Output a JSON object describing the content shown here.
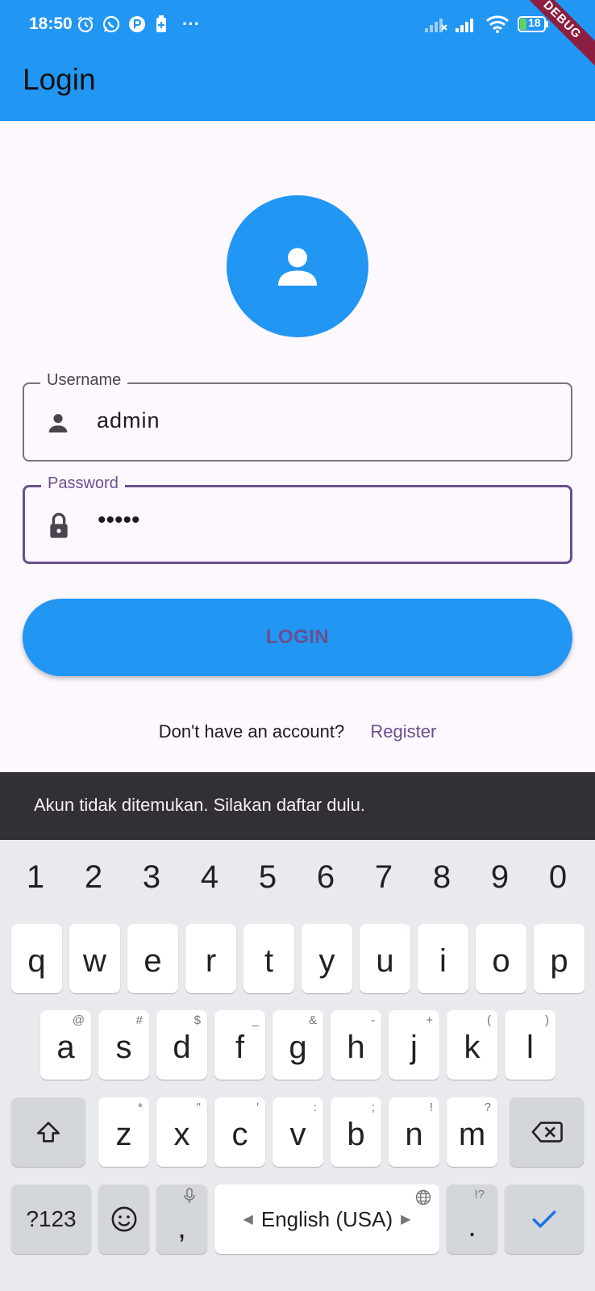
{
  "status_bar": {
    "time": "18:50",
    "battery": "18",
    "icons": [
      "alarm-icon",
      "whatsapp-icon",
      "app-icon",
      "battery-saver-icon",
      "more-icon",
      "signal-1-icon",
      "signal-2-icon",
      "wifi-icon",
      "battery-icon"
    ]
  },
  "debug_banner": "DEBUG",
  "app_bar": {
    "title": "Login"
  },
  "form": {
    "username": {
      "label": "Username",
      "value": "admin"
    },
    "password": {
      "label": "Password",
      "value": "•••••"
    },
    "login_button": "LOGIN",
    "register_prompt": "Don't have an account?",
    "register_link": "Register"
  },
  "snackbar": {
    "message": "Akun tidak ditemukan. Silakan daftar dulu."
  },
  "keyboard": {
    "numbers": [
      "1",
      "2",
      "3",
      "4",
      "5",
      "6",
      "7",
      "8",
      "9",
      "0"
    ],
    "row1": [
      "q",
      "w",
      "e",
      "r",
      "t",
      "y",
      "u",
      "i",
      "o",
      "p"
    ],
    "row2": [
      {
        "ch": "a",
        "hint": "@"
      },
      {
        "ch": "s",
        "hint": "#"
      },
      {
        "ch": "d",
        "hint": "$"
      },
      {
        "ch": "f",
        "hint": "_"
      },
      {
        "ch": "g",
        "hint": "&"
      },
      {
        "ch": "h",
        "hint": "-"
      },
      {
        "ch": "j",
        "hint": "+"
      },
      {
        "ch": "k",
        "hint": "("
      },
      {
        "ch": "l",
        "hint": ")"
      }
    ],
    "row3": [
      {
        "ch": "z",
        "hint": "*"
      },
      {
        "ch": "x",
        "hint": "\""
      },
      {
        "ch": "c",
        "hint": "'"
      },
      {
        "ch": "v",
        "hint": ":"
      },
      {
        "ch": "b",
        "hint": ";"
      },
      {
        "ch": "n",
        "hint": "!"
      },
      {
        "ch": "m",
        "hint": "?"
      }
    ],
    "symbols_key": "?123",
    "comma": ",",
    "period": ".",
    "period_hint": "!?",
    "space_label": "English (USA)",
    "accent_color": "#1a73e8"
  }
}
